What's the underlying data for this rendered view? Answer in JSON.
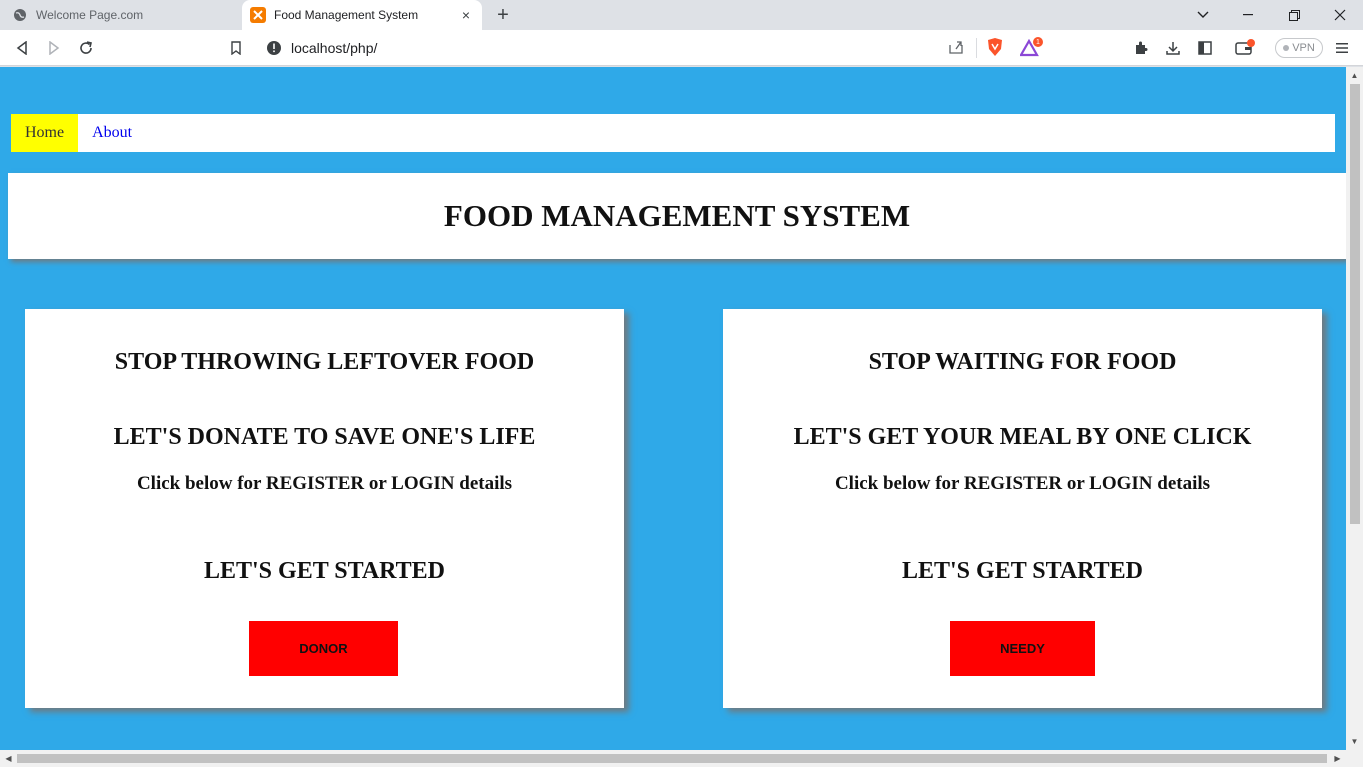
{
  "browser": {
    "tabs": [
      {
        "title": "Welcome Page.com",
        "favicon": "globe-icon"
      },
      {
        "title": "Food Management System",
        "favicon": "xampp-icon",
        "close": "×"
      }
    ],
    "url": "localhost/php/",
    "vpn_label": "VPN",
    "notification_count": "1"
  },
  "page": {
    "nav": [
      {
        "label": "Home",
        "active": true
      },
      {
        "label": "About",
        "active": false
      }
    ],
    "banner_title": "FOOD MANAGEMENT SYSTEM",
    "cards": {
      "donor": {
        "heading1": "STOP THROWING LEFTOVER FOOD",
        "heading2": "LET'S DONATE TO SAVE ONE'S LIFE",
        "subtext": "Click below for REGISTER or LOGIN details",
        "heading3": "LET'S GET STARTED",
        "button_label": "DONOR"
      },
      "needy": {
        "heading1": "STOP WAITING FOR FOOD",
        "heading2": "LET'S GET YOUR MEAL BY ONE CLICK",
        "subtext": "Click below for REGISTER or LOGIN details",
        "heading3": "LET'S GET STARTED",
        "button_label": "NEEDY"
      }
    }
  },
  "colors": {
    "page_bg": "#2fa9e8",
    "button": "#ff0000",
    "nav_active": "#ffff00"
  }
}
